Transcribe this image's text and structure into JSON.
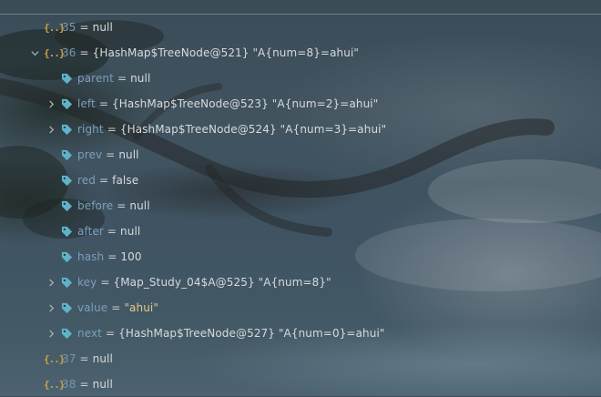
{
  "rows": [
    {
      "name": "35",
      "value": "null",
      "icon": "array-element-icon",
      "expand": "none"
    },
    {
      "name": "36",
      "value": "{HashMap$TreeNode@521} \"A{num=8}=ahui\"",
      "icon": "array-element-icon",
      "expand": "expanded"
    },
    {
      "name": "parent",
      "value": "null",
      "icon": "field-tag-icon",
      "expand": "none"
    },
    {
      "name": "left",
      "value": "{HashMap$TreeNode@523} \"A{num=2}=ahui\"",
      "icon": "field-tag-icon",
      "expand": "collapsed"
    },
    {
      "name": "right",
      "value": "{HashMap$TreeNode@524} \"A{num=3}=ahui\"",
      "icon": "field-tag-icon",
      "expand": "collapsed"
    },
    {
      "name": "prev",
      "value": "null",
      "icon": "field-tag-icon",
      "expand": "none"
    },
    {
      "name": "red",
      "value": "false",
      "icon": "field-tag-icon",
      "expand": "none"
    },
    {
      "name": "before",
      "value": "null",
      "icon": "field-tag-icon",
      "expand": "none"
    },
    {
      "name": "after",
      "value": "null",
      "icon": "field-tag-icon",
      "expand": "none"
    },
    {
      "name": "hash",
      "value": "100",
      "icon": "field-tag-icon",
      "expand": "none"
    },
    {
      "name": "key",
      "value": "{Map_Study_04$A@525} \"A{num=8}\"",
      "icon": "field-tag-icon",
      "expand": "collapsed"
    },
    {
      "name": "value",
      "value": "\"ahui\"",
      "icon": "field-tag-icon",
      "expand": "collapsed",
      "value_type": "string"
    },
    {
      "name": "next",
      "value": "{HashMap$TreeNode@527} \"A{num=0}=ahui\"",
      "icon": "field-tag-icon",
      "expand": "collapsed"
    },
    {
      "name": "37",
      "value": "null",
      "icon": "array-element-icon",
      "expand": "none"
    },
    {
      "name": "38",
      "value": "null",
      "icon": "array-element-icon",
      "expand": "none"
    }
  ],
  "eq_sign": "=",
  "array_icon_glyph": "{..}",
  "colors": {
    "field_name": "#7b9fbd",
    "index_name": "#7a95ab",
    "value_text": "#d7dadd",
    "string_value": "#e3c98b",
    "array_icon": "#c9a24a",
    "tag_icon": "#5fb3c8"
  }
}
